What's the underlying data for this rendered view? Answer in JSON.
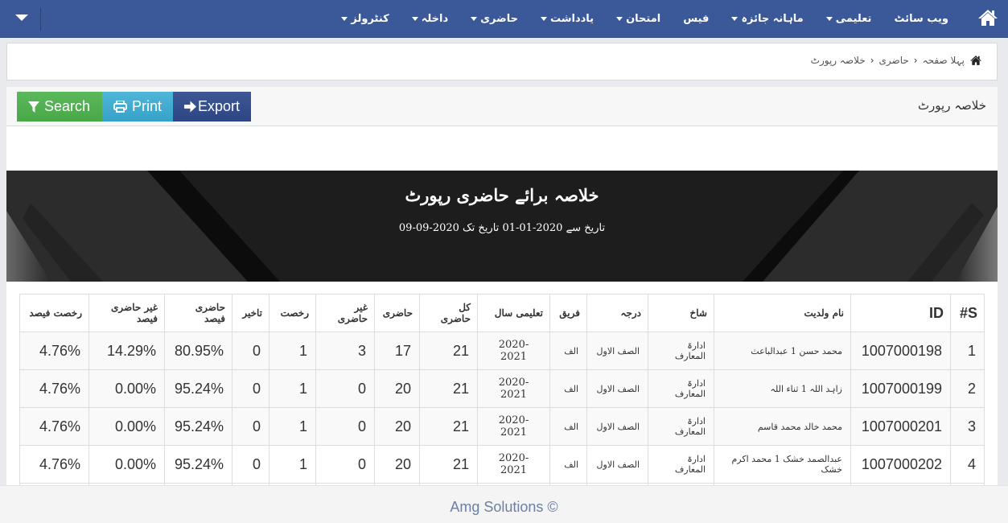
{
  "navbar": {
    "home_icon": "home-icon",
    "toggle_icon": "caret-down-icon",
    "items": [
      {
        "label": "کنٹرولز",
        "dropdown": true
      },
      {
        "label": "داخلہ",
        "dropdown": true
      },
      {
        "label": "حاضری",
        "dropdown": true
      },
      {
        "label": "یادداشت",
        "dropdown": true
      },
      {
        "label": "امتحان",
        "dropdown": true
      },
      {
        "label": "فیس",
        "dropdown": false
      },
      {
        "label": "ماہانہ جائزہ",
        "dropdown": true
      },
      {
        "label": "تعلیمی",
        "dropdown": true
      },
      {
        "label": "ویب سائٹ",
        "dropdown": false
      }
    ]
  },
  "breadcrumb": {
    "items": [
      "پہلا صفحہ",
      "حاضری",
      "خلاصہ رپورٹ"
    ],
    "separator": "›"
  },
  "panel": {
    "title": "خلاصہ رپورٹ",
    "buttons": {
      "search": "Search",
      "print": "Print",
      "export": "Export"
    },
    "colors": {
      "search": "#5cb85c",
      "print": "#3fabd1",
      "export": "#344f8c"
    }
  },
  "banner": {
    "title": "خلاصہ برائے حاضری رپورٹ",
    "subtitle": "تاریخ سے 2020-01-01 تاریخ تک 2020-09-09"
  },
  "table": {
    "headers": [
      "S#",
      "ID",
      "نام ولدیت",
      "شاخ",
      "درجہ",
      "فریق",
      "تعلیمی سال",
      "کل حاضری",
      "حاضری",
      "غیر حاضری",
      "رخصت",
      "تاخیر",
      "حاضری فیصد",
      "غیر حاضری فیصد",
      "رخصت فیصد"
    ],
    "rows": [
      {
        "sn": "1",
        "id": "1007000198",
        "name": "محمد حسن 1 عبدالباعث",
        "branch": "ادارۃ المعارف",
        "grade": "الصف الاول",
        "section": "الف",
        "year": "2020-2021",
        "total": "21",
        "present": "17",
        "absent": "3",
        "leave": "1",
        "late": "0",
        "present_pct": "80.95%",
        "absent_pct": "14.29%",
        "leave_pct": "4.76%"
      },
      {
        "sn": "2",
        "id": "1007000199",
        "name": "زاہد اللہ 1 ثناء اللہ",
        "branch": "ادارۃ المعارف",
        "grade": "الصف الاول",
        "section": "الف",
        "year": "2020-2021",
        "total": "21",
        "present": "20",
        "absent": "0",
        "leave": "1",
        "late": "0",
        "present_pct": "95.24%",
        "absent_pct": "0.00%",
        "leave_pct": "4.76%"
      },
      {
        "sn": "3",
        "id": "1007000201",
        "name": "محمد خالد محمد قاسم",
        "branch": "ادارۃ المعارف",
        "grade": "الصف الاول",
        "section": "الف",
        "year": "2020-2021",
        "total": "21",
        "present": "20",
        "absent": "0",
        "leave": "1",
        "late": "0",
        "present_pct": "95.24%",
        "absent_pct": "0.00%",
        "leave_pct": "4.76%"
      },
      {
        "sn": "4",
        "id": "1007000202",
        "name": "عبدالصمد خشک 1 محمد اکرم خشک",
        "branch": "ادارۃ المعارف",
        "grade": "الصف الاول",
        "section": "الف",
        "year": "2020-2021",
        "total": "21",
        "present": "20",
        "absent": "0",
        "leave": "1",
        "late": "0",
        "present_pct": "95.24%",
        "absent_pct": "0.00%",
        "leave_pct": "4.76%"
      }
    ]
  },
  "footer": {
    "text": "Amg Solutions ©"
  }
}
